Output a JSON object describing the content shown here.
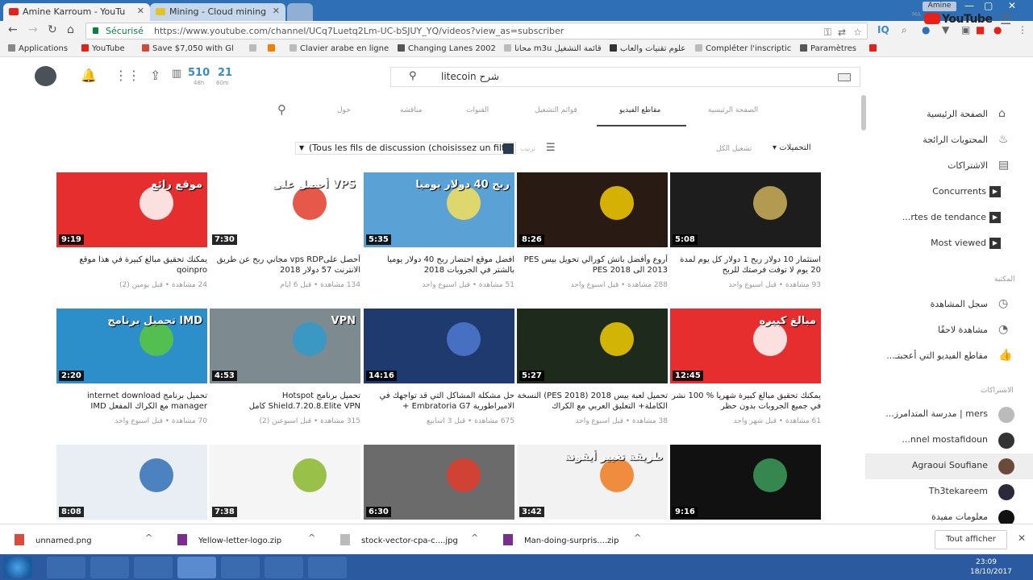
{
  "browser": {
    "tabs": [
      {
        "title": "Amine Karroum - YouTu"
      },
      {
        "title": "Mining - Cloud mining"
      }
    ],
    "window_user": "Amine",
    "window_controls": [
      "—",
      "▢",
      "✕"
    ],
    "security_label": "Sécurisé",
    "url": "https://www.youtube.com/channel/UCq7Luetq2Lm-UC-bSJUY_YQ/videos?view_as=subscriber",
    "bookmarks": [
      {
        "label": "Applications",
        "color": "#888888"
      },
      {
        "label": "YouTube",
        "color": "#e62117"
      },
      {
        "label": "Save $7,050 with Gl",
        "color": "#d44638"
      },
      {
        "label": "",
        "color": "#999999"
      },
      {
        "label": "",
        "color": "#f57d00"
      },
      {
        "label": "Clavier arabe en ligne",
        "color": "#999999"
      },
      {
        "label": "Changing Lanes 2002",
        "color": "#555555"
      },
      {
        "label": "محانا m3u قائمة التشغيل",
        "color": "#999999"
      },
      {
        "label": "علوم تقنيات والعاب",
        "color": "#333333"
      },
      {
        "label": "Compléter l'inscriptic",
        "color": "#999999"
      },
      {
        "label": "Paramètres",
        "color": "#555555"
      },
      {
        "label": "",
        "color": "#e62117"
      }
    ]
  },
  "header": {
    "stat1_value": "510",
    "stat1_sub": "48h",
    "stat2_value": "21",
    "stat2_sub": "60m",
    "search_query": "litecoin شرح",
    "logo_text": "YouTube",
    "logo_region": "MA"
  },
  "channel_tabs": [
    "الصفحة الرئيسية",
    "مقاطع الفيديو",
    "قوائم التشغيل",
    "القنوات",
    "مناقشة",
    "حول"
  ],
  "filter": {
    "dropdown_value": "(Tous les fils de discussion (choisissez un filtre",
    "sort_label": "ترتيب",
    "right_label": "تشغيل الكل",
    "right_label2": "التحميلات"
  },
  "sidebar": {
    "main": [
      {
        "label": "الصفحة الرئيسية",
        "icon": "⌂"
      },
      {
        "label": "المحتويات الرائجة",
        "icon": "♨"
      },
      {
        "label": "الاشتراكات",
        "icon": "▤"
      },
      {
        "label": "Concurrents",
        "icon": "▶"
      },
      {
        "label": "...rtes de tendance",
        "icon": "▶"
      },
      {
        "label": "Most viewed",
        "icon": "▶"
      }
    ],
    "library_header": "المكتبة",
    "library": [
      {
        "label": "سجل المشاهدة",
        "icon": "◷"
      },
      {
        "label": "مشاهدة لاحقًا",
        "icon": "◔"
      },
      {
        "label": "...مقاطع الفيديو التي أعجبتـ",
        "icon": "👍"
      }
    ],
    "subs_header": "الاشتراكات",
    "subscriptions": [
      {
        "label": "...مدرسة المتدامرز | mers"
      },
      {
        "label": "...nnel mostafidoun"
      },
      {
        "label": "Agraoui Soufiane"
      },
      {
        "label": "Th3tekareem"
      },
      {
        "label": "معلومات مفيدة"
      }
    ]
  },
  "videos": [
    {
      "duration": "5:08",
      "title": "استثمار 10 دولار ربح 1 دولار كل يوم لمدة 20 يوم لا توفت فرصتك للربح",
      "meta": "93 مشاهدة • قبل أسبوع واحد",
      "bg": "#1d1d1d",
      "accent": "#ccb25a",
      "overlay": ""
    },
    {
      "duration": "8:26",
      "title": "أروع وأفضل باتش كورالي تحويل بيس PES 2013 الى PES 2018",
      "meta": "288 مشاهدة • قبل أسبوع واحد",
      "bg": "#2a1a14",
      "accent": "#f2cd00",
      "overlay": ""
    },
    {
      "duration": "5:35",
      "title": "افضل موقع احتضار ربح 40 دولار يوميا بالشتر في الجروبات 2018",
      "meta": "51 مشاهدة • قبل أسبوع واحد",
      "bg": "#5aa1d6",
      "accent": "#f6e05c",
      "overlay": "ربح 40 دولار يوميا"
    },
    {
      "duration": "7:30",
      "title": "أحصل علىvps RDP مجاني ربح عن طريق الانترنت 57 دولار 2018",
      "meta": "134 مشاهدة • قبل 6 أيام",
      "bg": "#ffffff",
      "accent": "#e23b2a",
      "overlay": "أحصل على VPS"
    },
    {
      "duration": "9:19",
      "title": "يمكنك تحقيق مبالغ كبيرة في هذا موقع qoinpro",
      "meta": "24 مشاهدة • قبل يومين (2)",
      "bg": "#e62e2e",
      "accent": "#ffffff",
      "overlay": "موقع رائع"
    },
    {
      "duration": "12:45",
      "title": "يمكنك تحقيق مبالغ كبيرة شهريا % 100 نشر في جميع الجروبات بدون حظر",
      "meta": "61 مشاهدة • قبل شهر واحد",
      "bg": "#e62e2e",
      "accent": "#ffffff",
      "overlay": "مبالغ كبيره"
    },
    {
      "duration": "5:27",
      "title": "تحميل لعبة بيس 2018 (PES 2018) النسخة الكاملة+ التعليق العربي مع الكراك",
      "meta": "38 مشاهدة • قبل أسبوع واحد",
      "bg": "#1e2a1c",
      "accent": "#f2cd00",
      "overlay": ""
    },
    {
      "duration": "14:16",
      "title": "حل مشكلة المشاكل التي قد تواجهك في الامبراطورية Embratoria G7 +",
      "meta": "675 مشاهدة • قبل 3 أسابيع",
      "bg": "#1e3a6e",
      "accent": "#4f7ad1",
      "overlay": ""
    },
    {
      "duration": "4:53",
      "title": "تحميل برنامج Hotspot Shield.7.20.8.Elite VPN كامل",
      "meta": "315 مشاهدة • قبل أسبوعين (2)",
      "bg": "#7d8a8f",
      "accent": "#2f9acb",
      "overlay": "VPN"
    },
    {
      "duration": "2:20",
      "title": "تحميل برنامج internet download manager مع الكراك المفعل IMD",
      "meta": "70 مشاهدة • قبل أسبوع واحد",
      "bg": "#2d8fc9",
      "accent": "#5ac83c",
      "overlay": "تحميل برنامج IMD"
    },
    {
      "duration": "9:16",
      "title": "",
      "meta": "",
      "bg": "#111111",
      "accent": "#3c9c5a",
      "overlay": ""
    },
    {
      "duration": "3:42",
      "title": "",
      "meta": "",
      "bg": "#f2f2f2",
      "accent": "#f07a1f",
      "overlay": "طريقة تغيير أيقونة"
    },
    {
      "duration": "6:30",
      "title": "",
      "meta": "",
      "bg": "#6b6b6b",
      "accent": "#e23b2a",
      "overlay": ""
    },
    {
      "duration": "7:38",
      "title": "",
      "meta": "",
      "bg": "#f5f5f5",
      "accent": "#88b72b",
      "overlay": ""
    },
    {
      "duration": "8:08",
      "title": "",
      "meta": "",
      "bg": "#e8eef4",
      "accent": "#2f6fb5",
      "overlay": ""
    }
  ],
  "downloads": {
    "items": [
      {
        "name": "unnamed.png",
        "color": "#d94c3d"
      },
      {
        "name": "Yellow-letter-logo.zip",
        "color": "#7a2f8f"
      },
      {
        "name": "stock-vector-cpa-c....jpg",
        "color": "#bbbbbb"
      },
      {
        "name": "Man-doing-surpris....zip",
        "color": "#7a2f8f"
      }
    ],
    "show_all": "Tout afficher"
  },
  "taskbar": {
    "time": "23:09",
    "date": "18/10/2017"
  }
}
